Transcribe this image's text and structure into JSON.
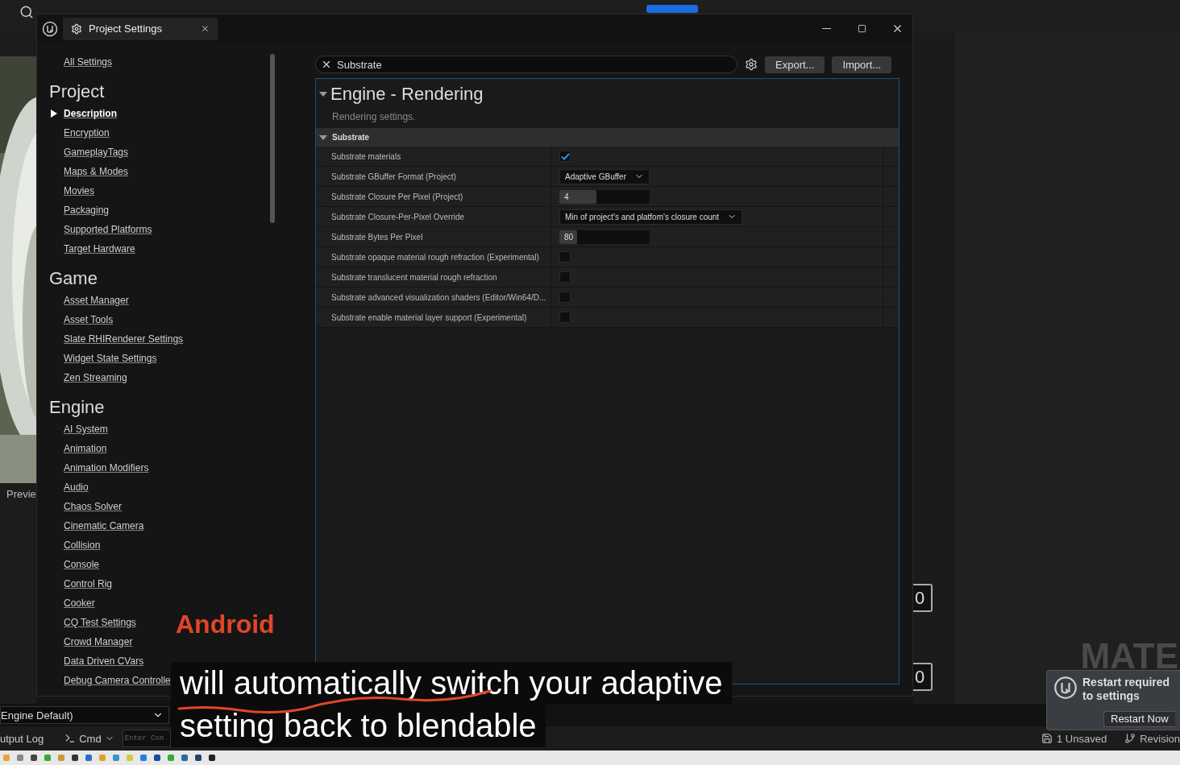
{
  "editor": {
    "preview_label": "Previe",
    "details_dropdown": "Engine Default)",
    "output_log": "utput Log",
    "cmd": "Cmd",
    "console": {
      "placeholder": "Enter Con"
    },
    "fields": [
      "0",
      "0"
    ],
    "graph_label": "MATE",
    "notification": {
      "message": "Restart required to settings",
      "button": "Restart Now"
    },
    "status": [
      "1 Unsaved",
      "Revision"
    ]
  },
  "window": {
    "tab_title": "Project Settings",
    "nav": {
      "top_link": "All Settings",
      "sections": [
        {
          "title": "Project",
          "items": [
            {
              "label": "Description",
              "selected": true
            },
            {
              "label": "Encryption",
              "selected": false
            },
            {
              "label": "GameplayTags",
              "selected": false
            },
            {
              "label": "Maps & Modes",
              "selected": false
            },
            {
              "label": "Movies",
              "selected": false
            },
            {
              "label": "Packaging",
              "selected": false
            },
            {
              "label": "Supported Platforms",
              "selected": false
            },
            {
              "label": "Target Hardware",
              "selected": false
            }
          ]
        },
        {
          "title": "Game",
          "items": [
            {
              "label": "Asset Manager",
              "selected": false
            },
            {
              "label": "Asset Tools",
              "selected": false
            },
            {
              "label": "Slate RHIRenderer Settings",
              "selected": false
            },
            {
              "label": "Widget State Settings",
              "selected": false
            },
            {
              "label": "Zen Streaming",
              "selected": false
            }
          ]
        },
        {
          "title": "Engine",
          "items": [
            {
              "label": "AI System",
              "selected": false
            },
            {
              "label": "Animation",
              "selected": false
            },
            {
              "label": "Animation Modifiers",
              "selected": false
            },
            {
              "label": "Audio",
              "selected": false
            },
            {
              "label": "Chaos Solver",
              "selected": false
            },
            {
              "label": "Cinematic Camera",
              "selected": false
            },
            {
              "label": "Collision",
              "selected": false
            },
            {
              "label": "Console",
              "selected": false
            },
            {
              "label": "Control Rig",
              "selected": false
            },
            {
              "label": "Cooker",
              "selected": false
            },
            {
              "label": "CQ Test Settings",
              "selected": false
            },
            {
              "label": "Crowd Manager",
              "selected": false
            },
            {
              "label": "Data Driven CVars",
              "selected": false
            },
            {
              "label": "Debug Camera Controlle",
              "selected": false
            }
          ]
        }
      ]
    },
    "search": {
      "value": "Substrate"
    },
    "buttons": [
      "Export...",
      "Import..."
    ],
    "category": {
      "title": "Engine - Rendering",
      "description": "Rendering settings.",
      "group": {
        "title": "Substrate",
        "expanded": true
      },
      "rows": [
        {
          "label": "Substrate materials",
          "kind": "checkbox",
          "checked": true
        },
        {
          "label": "Substrate GBuffer Format (Project)",
          "kind": "dropdown",
          "value": "Adaptive GBuffer"
        },
        {
          "label": "Substrate Closure Per Pixel (Project)",
          "kind": "number",
          "value": "4",
          "level": 0.41
        },
        {
          "label": "Substrate Closure-Per-Pixel Override",
          "kind": "dropdown",
          "value": "Min of project's and platfom's closure count"
        },
        {
          "label": "Substrate Bytes Per Pixel",
          "kind": "number",
          "value": "80",
          "level": 0.2
        },
        {
          "label": "Substrate opaque material rough refraction (Experimental)",
          "kind": "checkbox",
          "checked": false
        },
        {
          "label": "Substrate translucent material rough refraction",
          "kind": "checkbox",
          "checked": false
        },
        {
          "label": "Substrate advanced visualization shaders (Editor/Win64/D...",
          "kind": "checkbox",
          "checked": false
        },
        {
          "label": "Substrate enable material layer support (Experimental)",
          "kind": "checkbox",
          "checked": false
        }
      ]
    }
  },
  "caption": {
    "annotation": "Android",
    "lines": [
      "will automatically switch your adaptive",
      "setting back to blendable"
    ]
  }
}
